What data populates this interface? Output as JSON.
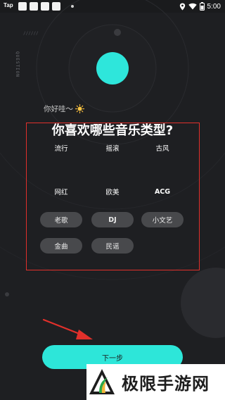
{
  "status_bar": {
    "app_label": "Tap",
    "time": "5:00",
    "icons": [
      "app-icon",
      "app-icon",
      "app-icon",
      "app-icon",
      "dot",
      "location-icon",
      "wifi-icon",
      "battery-icon"
    ]
  },
  "side_label": "QUESTION",
  "slash_decoration": "//////",
  "greeting": {
    "text": "你好哇～",
    "icon": "sun-icon"
  },
  "question": "你喜欢哪些音乐类型?",
  "tags": [
    {
      "label": "流行",
      "style": "light",
      "selected": true
    },
    {
      "label": "摇滚",
      "style": "light",
      "selected": true
    },
    {
      "label": "古风",
      "style": "light",
      "selected": true
    },
    {
      "label": "网红",
      "style": "light",
      "selected": true
    },
    {
      "label": "欧美",
      "style": "light",
      "selected": true
    },
    {
      "label": "ACG",
      "style": "light",
      "selected": true
    },
    {
      "label": "老歌",
      "style": "dark",
      "selected": false
    },
    {
      "label": "DJ",
      "style": "dark",
      "selected": false
    },
    {
      "label": "小文艺",
      "style": "dark",
      "selected": false
    },
    {
      "label": "金曲",
      "style": "dark",
      "selected": false
    },
    {
      "label": "民谣",
      "style": "dark",
      "selected": false
    }
  ],
  "next_button": {
    "label": "下一步"
  },
  "watermark": {
    "text": "极限手游网"
  },
  "colors": {
    "background": "#1e1f22",
    "accent": "#2de6d9",
    "highlight": "#e1302b",
    "tag_light": "#f6f6f6",
    "tag_dark": "#48494c"
  }
}
